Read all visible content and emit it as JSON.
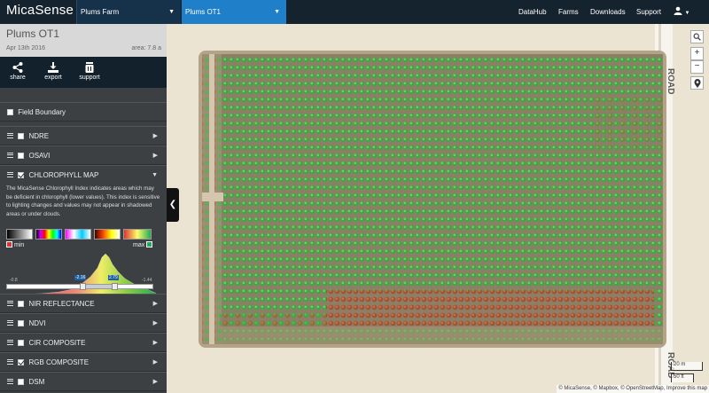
{
  "topbar": {
    "logo": "MicaSense",
    "farm": "Plums Farm",
    "map": "Plums OT1",
    "nav": [
      "DataHub",
      "Farms",
      "Downloads",
      "Support"
    ],
    "user_icon": "user-icon"
  },
  "sidebar": {
    "title": "Plums OT1",
    "date": "Apr 13th 2016",
    "area": "area: 7.8 a",
    "actions": [
      "share",
      "export",
      "support"
    ],
    "field_boundary": "Field Boundary",
    "layers": [
      {
        "label": "NDRE",
        "checked": false,
        "expanded": false
      },
      {
        "label": "OSAVI",
        "checked": false,
        "expanded": false
      },
      {
        "label": "CHLOROPHYLL MAP",
        "checked": true,
        "expanded": true
      },
      {
        "label": "NIR REFLECTANCE",
        "checked": false,
        "expanded": false
      },
      {
        "label": "NDVI",
        "checked": false,
        "expanded": false
      },
      {
        "label": "CIR COMPOSITE",
        "checked": false,
        "expanded": false
      },
      {
        "label": "RGB COMPOSITE",
        "checked": true,
        "expanded": false
      },
      {
        "label": "DSM",
        "checked": false,
        "expanded": false
      }
    ],
    "chlorophyll": {
      "description": "The MicaSense Chlorophyll Index indicates areas which may be deficient in chlorophyll (lower values). This index is sensitive to lighting changes and values may not appear in shadowed areas or under clouds.",
      "min_label": "min",
      "max_label": "max",
      "range_low": "-0.8",
      "range_high": "-1.44",
      "handle_a": "-2.16",
      "handle_b": "2.79",
      "slider_low_fraction": 0.52,
      "slider_high_fraction": 0.74
    }
  },
  "map": {
    "scale_m": "20 m",
    "scale_ft": "50 ft",
    "road_label": "ROAD",
    "attribution": "© MicaSense, © Mapbox, © OpenStreetMap, Improve this map"
  },
  "colors": {
    "topbar": "#15232f",
    "accent": "#1f7fc8",
    "sidebar": "#3d4042",
    "healthy": "#2fa83a",
    "deficient": "#d8342a"
  }
}
